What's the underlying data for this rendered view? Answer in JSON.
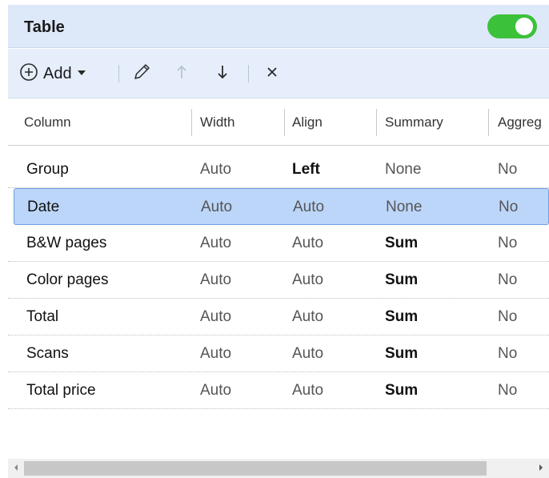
{
  "panel": {
    "title": "Table",
    "toggle_on": true,
    "toggle_color": "#3cc13b"
  },
  "toolbar": {
    "add_label": "Add",
    "add_icon": "plus-circle-icon",
    "dropdown_icon": "caret-down-icon",
    "edit_icon": "pencil-icon",
    "move_up_icon": "arrow-up-icon",
    "move_down_icon": "arrow-down-icon",
    "delete_icon": "close-icon"
  },
  "columns_headers": [
    "Column",
    "Width",
    "Align",
    "Summary",
    "Aggreg"
  ],
  "rows": [
    {
      "column": "Group",
      "width": "Auto",
      "align": "Left",
      "summary": "None",
      "aggregate": "No"
    },
    {
      "column": "Date",
      "width": "Auto",
      "align": "Auto",
      "summary": "None",
      "aggregate": "No"
    },
    {
      "column": "B&W pages",
      "width": "Auto",
      "align": "Auto",
      "summary": "Sum",
      "aggregate": "No"
    },
    {
      "column": "Color pages",
      "width": "Auto",
      "align": "Auto",
      "summary": "Sum",
      "aggregate": "No"
    },
    {
      "column": "Total",
      "width": "Auto",
      "align": "Auto",
      "summary": "Sum",
      "aggregate": "No"
    },
    {
      "column": "Scans",
      "width": "Auto",
      "align": "Auto",
      "summary": "Sum",
      "aggregate": "No"
    },
    {
      "column": "Total price",
      "width": "Auto",
      "align": "Auto",
      "summary": "Sum",
      "aggregate": "No"
    }
  ],
  "selected_row": "Date",
  "colors": {
    "header_bg": "#dde9f9",
    "toolbar_bg": "#e5eefa",
    "selection_bg": "#bcd6fa",
    "selection_border": "#6f9fe0"
  }
}
